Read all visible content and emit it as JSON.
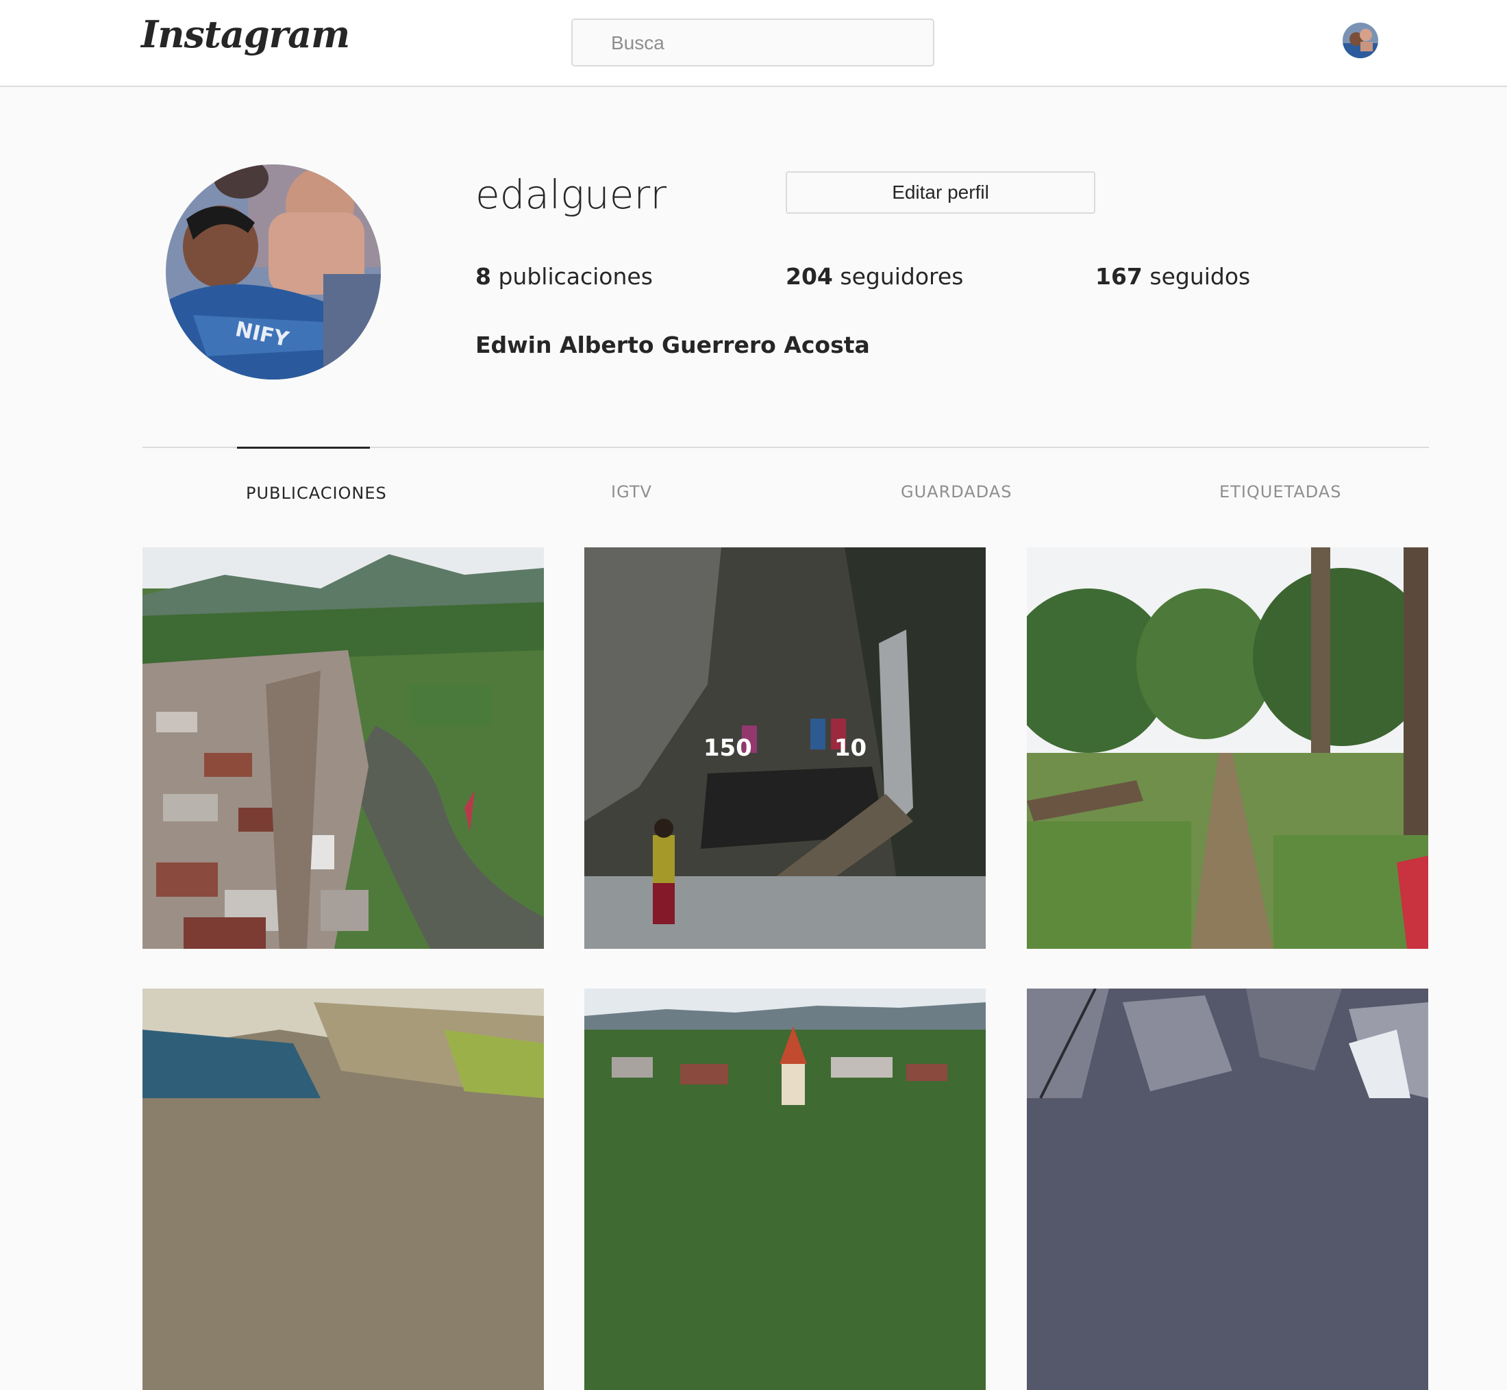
{
  "header": {
    "logo": "Instagram",
    "search_placeholder": "Busca",
    "avatar_icon": "user-avatar-icon"
  },
  "profile": {
    "username": "edalguerr",
    "edit_button": "Editar perfil",
    "posts_count": "8",
    "posts_label": "publicaciones",
    "followers_count": "204",
    "followers_label": "seguidores",
    "following_count": "167",
    "following_label": "seguidos",
    "full_name": "Edwin Alberto Guerrero Acosta"
  },
  "tabs": [
    {
      "label": "PUBLICACIONES",
      "active": true
    },
    {
      "label": "IGTV",
      "active": false
    },
    {
      "label": "GUARDADAS",
      "active": false
    },
    {
      "label": "ETIQUETADAS",
      "active": false
    }
  ],
  "posts": [
    {
      "subject": "aerial town by river"
    },
    {
      "subject": "waterfall with people",
      "likes": "150",
      "comments": "10"
    },
    {
      "subject": "forest trail"
    },
    {
      "subject": "river rocks"
    },
    {
      "subject": "town with church"
    },
    {
      "subject": "rocky stream"
    }
  ]
}
